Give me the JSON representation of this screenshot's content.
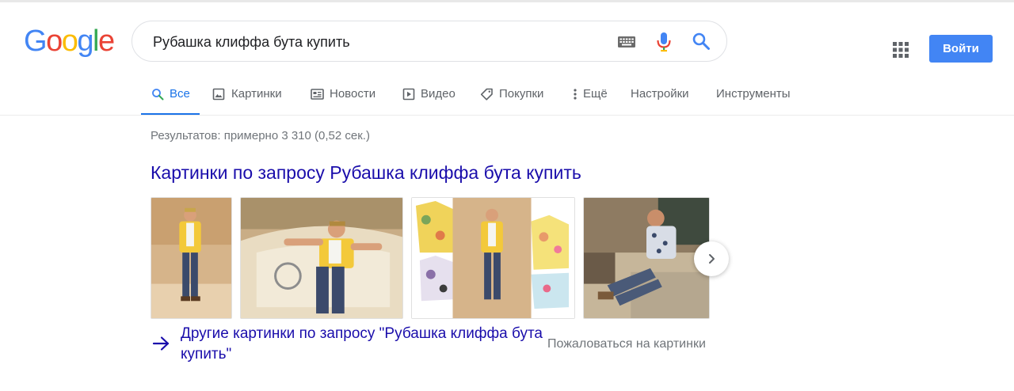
{
  "logo": {
    "letters": [
      "G",
      "o",
      "o",
      "g",
      "l",
      "e"
    ],
    "colors": [
      "#4285F4",
      "#EA4335",
      "#FBBC05",
      "#4285F4",
      "#34A853",
      "#EA4335"
    ]
  },
  "search": {
    "value": "Рубашка клиффа бута купить"
  },
  "header": {
    "signin_label": "Войти"
  },
  "tabs": [
    {
      "label": "Все",
      "icon": "search-icon",
      "active": true
    },
    {
      "label": "Картинки",
      "icon": "image-icon"
    },
    {
      "label": "Новости",
      "icon": "news-icon"
    },
    {
      "label": "Видео",
      "icon": "video-icon"
    },
    {
      "label": "Покупки",
      "icon": "tag-icon"
    },
    {
      "label": "Ещё",
      "icon": "more-vert-icon"
    },
    {
      "label": "Настройки"
    },
    {
      "label": "Инструменты"
    }
  ],
  "results": {
    "stats": "Результатов: примерно 3 310 (0,52 сек.)",
    "images_heading": "Картинки по запросу Рубашка клиффа бута купить",
    "more_images": "Другие картинки по запросу \"Рубашка клиффа бута купить\"",
    "report": "Пожаловаться на картинки"
  },
  "colors": {
    "accent": "#1a73e8",
    "link": "#1a0dab",
    "signin": "#4285f4"
  }
}
